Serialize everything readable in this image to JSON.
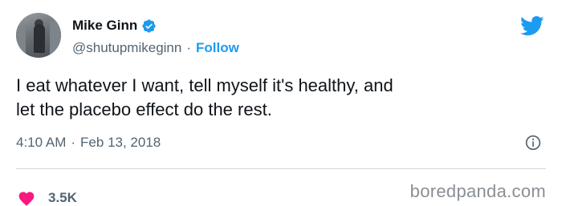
{
  "author": {
    "name": "Mike Ginn",
    "handle": "@shutupmikeginn",
    "separator": "·",
    "follow_label": "Follow",
    "verified_icon": "verified-badge-icon"
  },
  "tweet": {
    "line1": "I eat whatever I want, tell myself it's healthy, and",
    "line2": "let the placebo effect do the rest."
  },
  "meta": {
    "time": "4:10 AM",
    "separator": "·",
    "date": "Feb 13, 2018"
  },
  "engagement": {
    "likes": "3.5K"
  },
  "watermark": "boredpanda.com",
  "colors": {
    "accent": "#1d9bf0",
    "heart": "#f91880",
    "muted": "#536471"
  }
}
